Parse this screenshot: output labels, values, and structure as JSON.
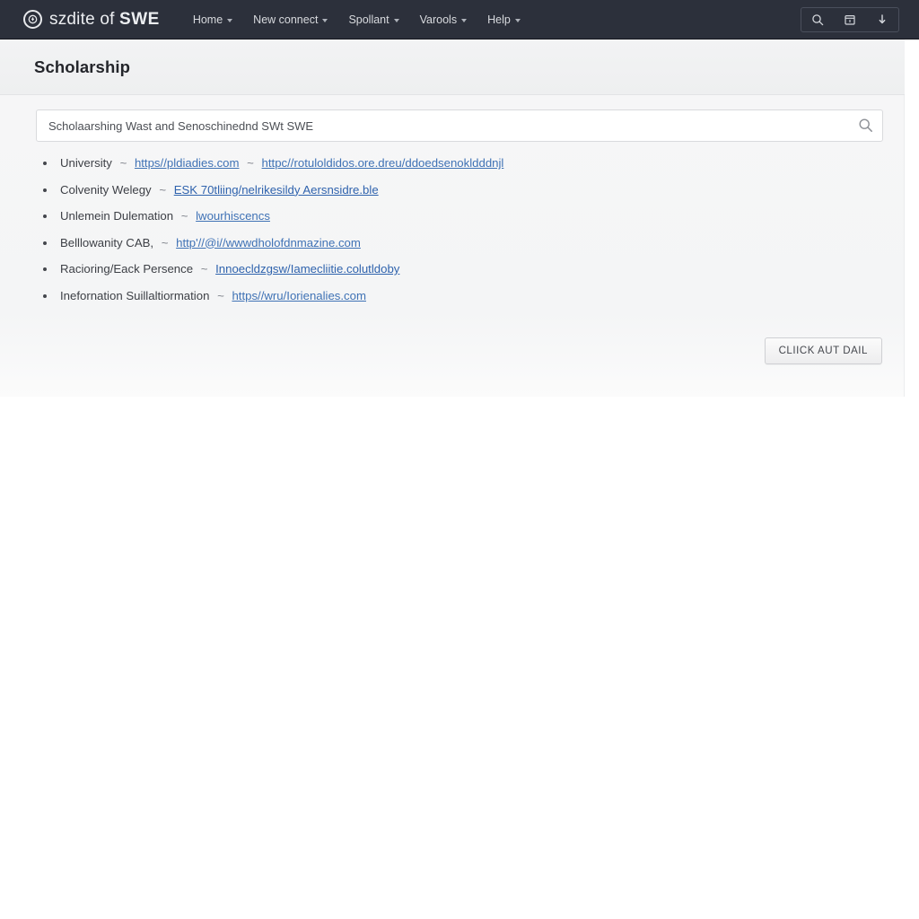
{
  "navbar": {
    "brand": {
      "icon": "target-circle-icon",
      "text_light": "szdite of ",
      "text_bold": "SWE"
    },
    "links": [
      {
        "label": "Home",
        "caret": true
      },
      {
        "label": "New connect",
        "caret": true
      },
      {
        "label": "Spollant",
        "caret": true
      },
      {
        "label": "Varools",
        "caret": true
      },
      {
        "label": "Help",
        "caret": true
      }
    ],
    "tools": [
      {
        "icon": "search-icon",
        "name": "navbar-search-button"
      },
      {
        "icon": "calendar-icon",
        "name": "navbar-calendar-button"
      },
      {
        "icon": "download-arrow-icon",
        "name": "navbar-download-button"
      }
    ]
  },
  "header": {
    "title": "Scholarship"
  },
  "search": {
    "value": "Scholaarshing Wast and Senoschinednd SWt SWE",
    "placeholder": "Scholaarshing Wast and Senoschinednd SWt SWE",
    "icon": "search-icon"
  },
  "list": {
    "items": [
      {
        "label": "University",
        "links": [
          {
            "text": "https//pldiadies.com",
            "style": "normal"
          },
          {
            "text": "httpc//rotuloldidos.ore.dreu/ddoedsenokldddnjl",
            "style": "normal"
          }
        ]
      },
      {
        "label": "Colvenity Welegy",
        "links": [
          {
            "text": "ESK 70tliing/nelrikesildy Aersnsidre.ble",
            "style": "deep"
          }
        ]
      },
      {
        "label": "Unlemein Dulemation",
        "links": [
          {
            "text": "lwourhiscencs",
            "style": "normal"
          }
        ]
      },
      {
        "label": "Belllowanity CAB,",
        "links": [
          {
            "text": "http'//@i//wwwdholofdnmazine.com",
            "style": "normal"
          }
        ]
      },
      {
        "label": "Racioring/Eack Persence",
        "links": [
          {
            "text": "Innoecldzgsw/Iamecliitie.colutldoby",
            "style": "deep"
          }
        ]
      },
      {
        "label": "Inefornation Suillaltiormation",
        "links": [
          {
            "text": "https//wru/Iorienalies.com",
            "style": "normal"
          }
        ]
      }
    ],
    "separator": "~"
  },
  "actions": {
    "primary_label": "CLIICK AUT DAIL"
  },
  "colors": {
    "navbar_bg": "#2c303b",
    "title_band_bg": "#f1f2f3",
    "content_bg": "#f5f6f7",
    "link": "#3f72b5",
    "link_deep": "#2f63ad",
    "text": "#3d4046"
  }
}
